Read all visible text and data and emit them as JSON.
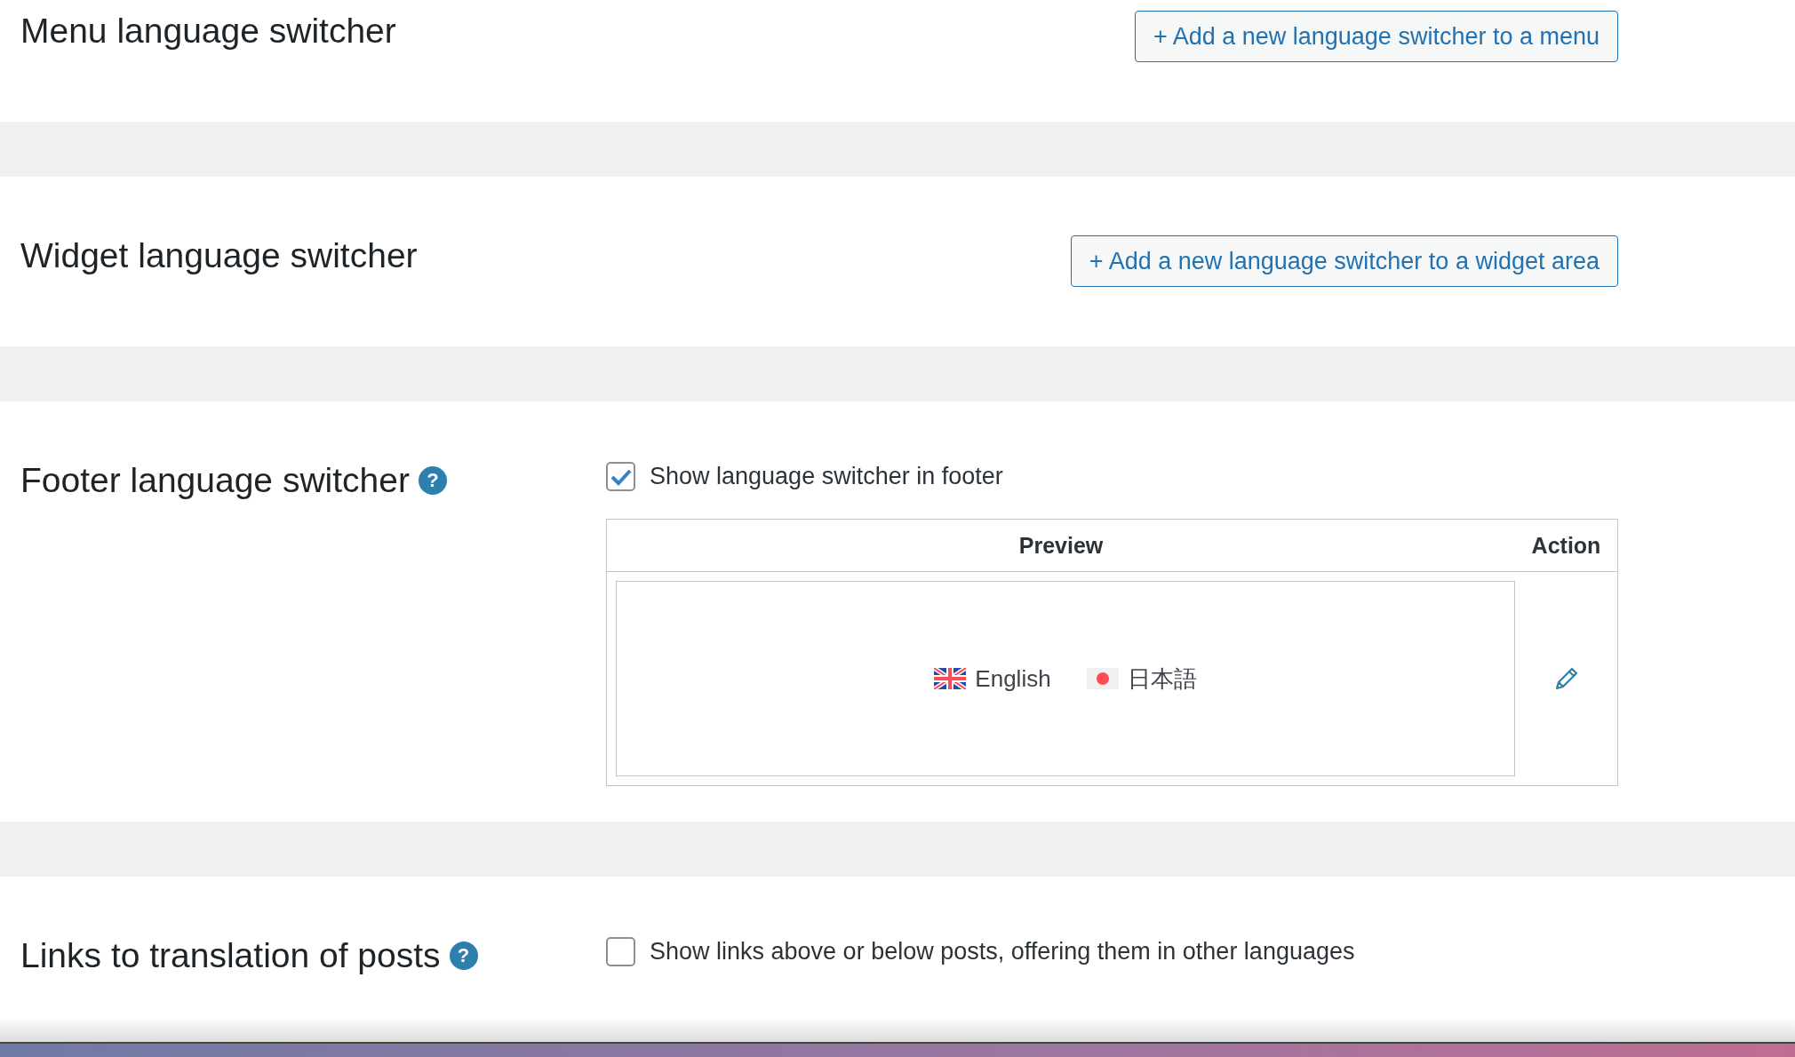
{
  "sections": [
    {
      "kind": "button",
      "title": "Menu language switcher",
      "button": "+ Add a new language switcher to a menu"
    },
    {
      "kind": "button",
      "title": "Widget language switcher",
      "button": "+ Add a new language switcher to a widget area"
    },
    {
      "kind": "footer",
      "title": "Footer language switcher",
      "help": "?",
      "checkbox": {
        "label": "Show language switcher in footer",
        "checked": true
      },
      "table": {
        "columns": [
          "Preview",
          "Action"
        ],
        "languages": [
          {
            "name": "English",
            "kind": "uk"
          },
          {
            "name": "日本語",
            "kind": "jp"
          }
        ]
      }
    },
    {
      "kind": "checkbox",
      "title": "Links to translation of posts",
      "help": "?",
      "checkbox": {
        "label": "Show links above or below posts, offering them in other languages",
        "checked": false
      }
    }
  ]
}
